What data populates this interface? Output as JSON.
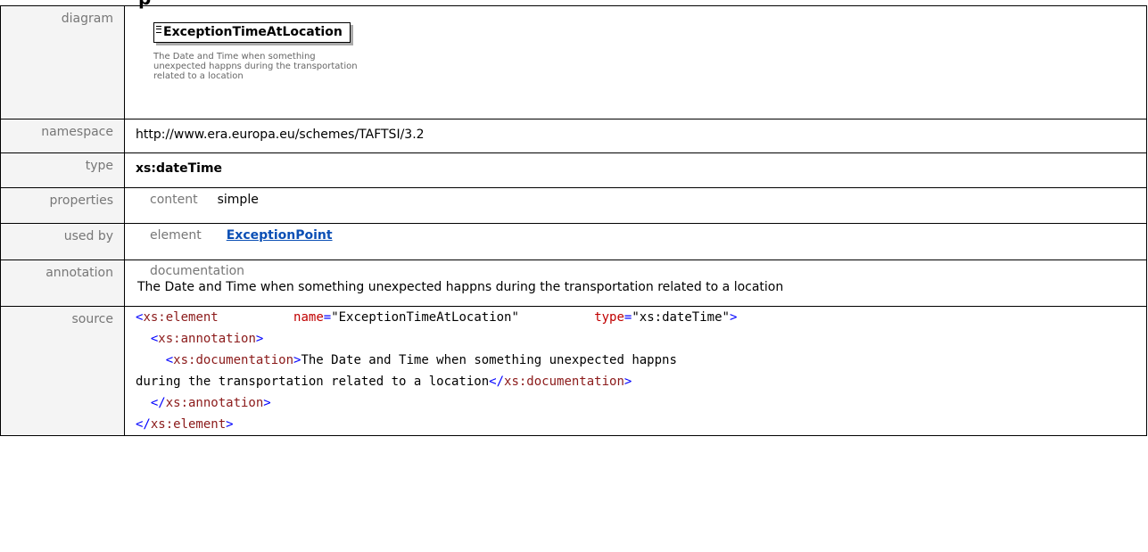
{
  "page_heading_fragment": "p",
  "rows": {
    "diagram": {
      "label": "diagram",
      "element_name": "ExceptionTimeAtLocation",
      "description": "The Date and Time when something unexpected happns during the transportation related to a location"
    },
    "namespace": {
      "label": "namespace",
      "value": "http://www.era.europa.eu/schemes/TAFTSI/3.2"
    },
    "type": {
      "label": "type",
      "value": "xs:dateTime"
    },
    "properties": {
      "label": "properties",
      "key": "content",
      "value": "simple"
    },
    "used_by": {
      "label": "used by",
      "key": "element",
      "value": "ExceptionPoint"
    },
    "annotation": {
      "label": "annotation",
      "key": "documentation",
      "value": "The Date and Time when something unexpected happns during the transportation related to a location"
    },
    "source": {
      "label": "source",
      "line1": {
        "open": "<",
        "tag": "xs:element",
        "attr1": "name",
        "eq1": "=",
        "val1": "\"ExceptionTimeAtLocation\"",
        "attr2": "type",
        "eq2": "=",
        "val2": "\"xs:dateTime\"",
        "close": ">"
      },
      "line2": {
        "open": "<",
        "tag": "xs:annotation",
        "close": ">"
      },
      "line3": {
        "open": "<",
        "tag": "xs:documentation",
        "close": ">",
        "text": "The Date and Time when something unexpected happns"
      },
      "line4": {
        "text": "during the transportation related to a location",
        "open": "</",
        "tag": "xs:documentation",
        "close": ">"
      },
      "line5": {
        "open": "</",
        "tag": "xs:annotation",
        "close": ">"
      },
      "line6": {
        "open": "</",
        "tag": "xs:element",
        "close": ">"
      }
    }
  }
}
